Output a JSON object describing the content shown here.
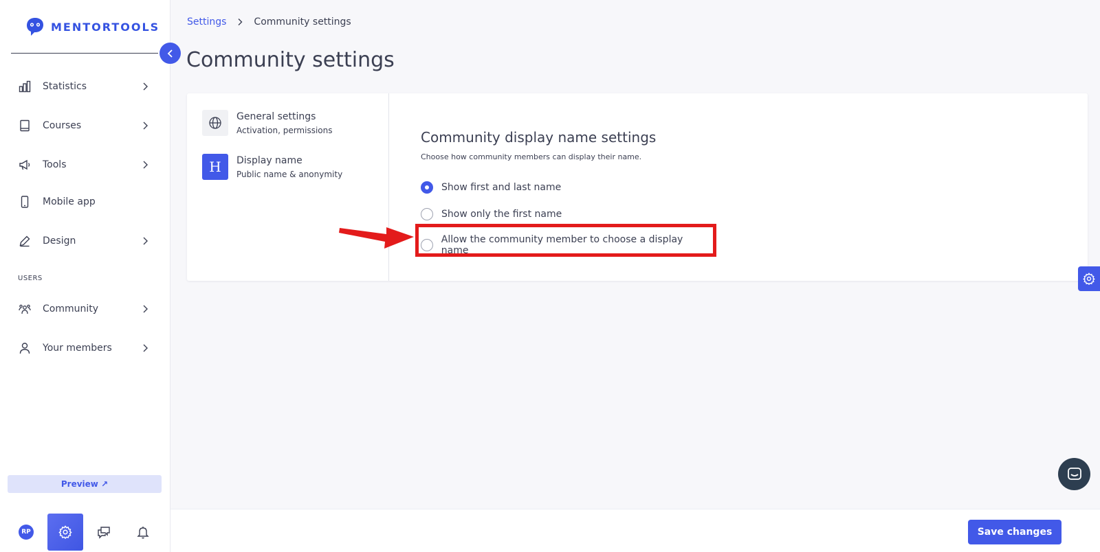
{
  "brand": {
    "name": "MENTORTOOLS",
    "color": "#3452e1"
  },
  "sidebar": {
    "items": [
      {
        "label": "Statistics",
        "icon": "bar-chart-icon",
        "has_chevron": true
      },
      {
        "label": "Courses",
        "icon": "book-icon",
        "has_chevron": true
      },
      {
        "label": "Tools",
        "icon": "megaphone-icon",
        "has_chevron": true
      },
      {
        "label": "Mobile app",
        "icon": "phone-icon",
        "has_chevron": false
      },
      {
        "label": "Design",
        "icon": "pencil-icon",
        "has_chevron": true
      }
    ],
    "section_users": "USERS",
    "user_items": [
      {
        "label": "Community",
        "icon": "people-icon",
        "has_chevron": true
      },
      {
        "label": "Your members",
        "icon": "person-icon",
        "has_chevron": true
      }
    ],
    "preview_label": "Preview ↗",
    "avatar_initials": "RP"
  },
  "breadcrumb": {
    "parent": "Settings",
    "current": "Community settings"
  },
  "page_title": "Community settings",
  "settings_nav": [
    {
      "title": "General settings",
      "subtitle": "Activation, permissions",
      "icon": "globe-icon"
    },
    {
      "title": "Display name",
      "subtitle": "Public name & anonymity",
      "icon": "heading-h-icon",
      "badge": "H"
    }
  ],
  "display_name": {
    "title": "Community display name settings",
    "description": "Choose how community members can display their name.",
    "options": [
      {
        "label": "Show first and last name",
        "checked": true
      },
      {
        "label": "Show only the first name",
        "checked": false
      },
      {
        "label": "Allow the community member to choose a display name",
        "checked": false
      }
    ]
  },
  "footer": {
    "save_label": "Save changes"
  },
  "colors": {
    "accent": "#4259e8",
    "highlight": "#e31b1b",
    "chat": "#2d3e50"
  }
}
